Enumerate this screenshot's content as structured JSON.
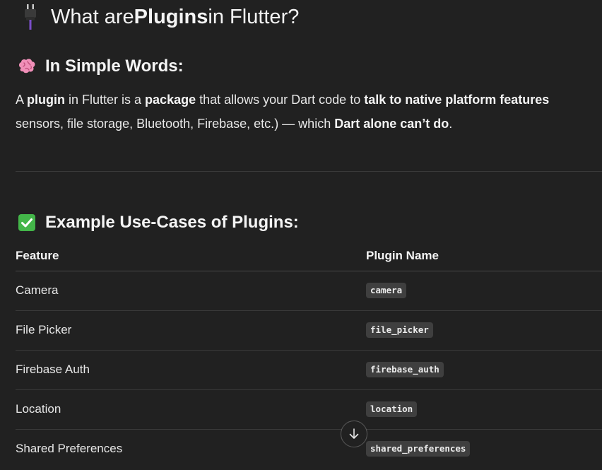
{
  "heading": {
    "prefix": "What are ",
    "bold": "Plugins",
    "suffix": " in Flutter?",
    "icon": "plug-icon"
  },
  "section1": {
    "icon": "brain-icon",
    "title": "In Simple Words:"
  },
  "paragraph": {
    "line1": [
      {
        "t": "A ",
        "b": false
      },
      {
        "t": "plugin",
        "b": true
      },
      {
        "t": " in Flutter is a ",
        "b": false
      },
      {
        "t": "package",
        "b": true
      },
      {
        "t": " that allows your Dart code to ",
        "b": false
      },
      {
        "t": "talk to native platform features",
        "b": true
      }
    ],
    "line2": [
      {
        "t": "sensors, file storage, Bluetooth, Firebase, etc.) — which ",
        "b": false
      },
      {
        "t": "Dart alone can’t do",
        "b": true
      },
      {
        "t": ".",
        "b": false
      }
    ]
  },
  "section2": {
    "icon": "check-icon",
    "title": "Example Use-Cases of Plugins:"
  },
  "table": {
    "headers": [
      "Feature",
      "Plugin Name"
    ],
    "rows": [
      {
        "feature": "Camera",
        "plugin": "camera"
      },
      {
        "feature": "File Picker",
        "plugin": "file_picker"
      },
      {
        "feature": "Firebase Auth",
        "plugin": "firebase_auth"
      },
      {
        "feature": "Location",
        "plugin": "location"
      },
      {
        "feature": "Shared Preferences",
        "plugin": "shared_preferences"
      }
    ]
  },
  "scroll_button": {
    "icon": "arrow-down-icon"
  },
  "colors": {
    "background": "#212121",
    "code_bg": "#3f3f3f",
    "text": "#ececec"
  }
}
